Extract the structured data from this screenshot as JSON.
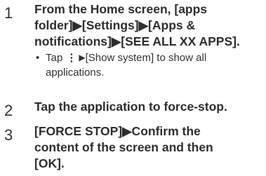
{
  "steps": [
    {
      "number": "1",
      "lines": [
        "From the Home screen, [apps",
        "folder]▶[Settings]▶[Apps &",
        "notifications]▶[SEE ALL XX APPS]."
      ],
      "note": {
        "bullet": "•",
        "prefix": "Tap",
        "icon": "more-vert-icon",
        "icon_glyph": "⋮",
        "arrow": "▶",
        "suffix": "[Show system] to show all",
        "continuation": "applications."
      }
    },
    {
      "number": "2",
      "lines": [
        "Tap the application to force-stop."
      ]
    },
    {
      "number": "3",
      "lines": [
        "[FORCE STOP]▶Confirm the",
        "content of the screen and then",
        "[OK]."
      ]
    }
  ]
}
